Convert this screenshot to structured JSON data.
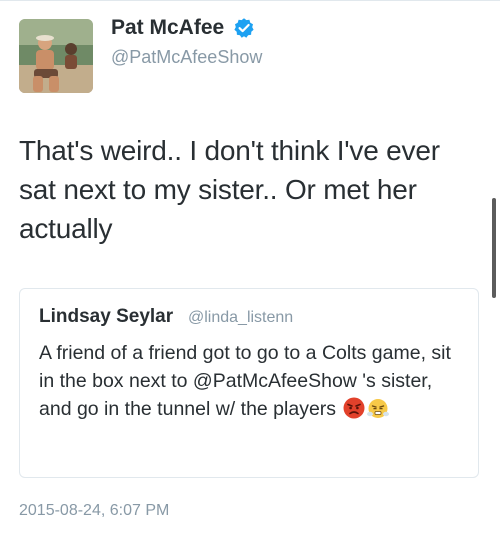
{
  "tweet": {
    "author": {
      "name": "Pat McAfee",
      "handle": "@PatMcAfeeShow",
      "verified": true
    },
    "text": "That's weird.. I don't think I've ever sat next to my sister.. Or met her actually",
    "quoted": {
      "name": "Lindsay Seylar",
      "handle": "@linda_listenn",
      "text": "A friend of a friend got to go to a Colts game, sit in the box next to @PatMcAfeeShow 's sister, and go in the tunnel w/ the players",
      "emojis": [
        "angry-face-icon",
        "face-with-steam-icon"
      ]
    },
    "timestamp": "2015-08-24, 6:07 PM"
  },
  "colors": {
    "text": "#292f33",
    "secondary": "#8899a6",
    "verified": "#1da1f2",
    "border": "#e1e8ed"
  }
}
